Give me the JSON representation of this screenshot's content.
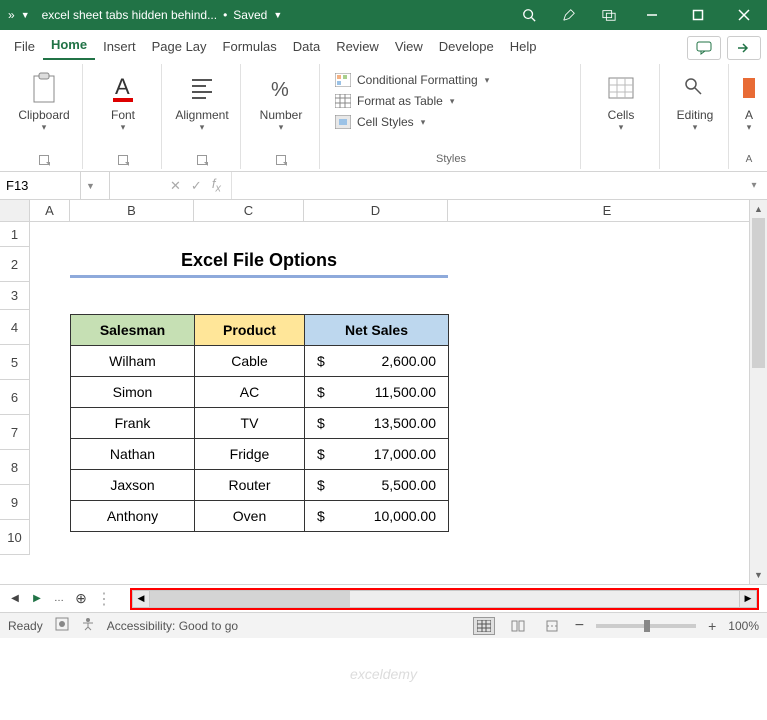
{
  "titlebar": {
    "filename": "excel sheet tabs hidden behind...",
    "saved": "Saved"
  },
  "tabs": {
    "file": "File",
    "home": "Home",
    "insert": "Insert",
    "pagelay": "Page Lay",
    "formulas": "Formulas",
    "data": "Data",
    "review": "Review",
    "view": "View",
    "developer": "Develope",
    "help": "Help"
  },
  "ribbon": {
    "clipboard": "Clipboard",
    "font": "Font",
    "alignment": "Alignment",
    "number": "Number",
    "condfmt": "Conditional Formatting",
    "fmttable": "Format as Table",
    "cellstyles": "Cell Styles",
    "styles": "Styles",
    "cells": "Cells",
    "editing": "Editing",
    "acut": "A"
  },
  "namebox": "F13",
  "columns": {
    "a": "A",
    "b": "B",
    "c": "C",
    "d": "D",
    "e": "E"
  },
  "rows": {
    "r1": "1",
    "r2": "2",
    "r3": "3",
    "r4": "4",
    "r5": "5",
    "r6": "6",
    "r7": "7",
    "r8": "8",
    "r9": "9",
    "r10": "10"
  },
  "sheet": {
    "title": "Excel File Options",
    "headers": {
      "salesman": "Salesman",
      "product": "Product",
      "netsales": "Net Sales"
    },
    "currency": "$",
    "data": [
      {
        "s": "Wilham",
        "p": "Cable",
        "n": "2,600.00"
      },
      {
        "s": "Simon",
        "p": "AC",
        "n": "11,500.00"
      },
      {
        "s": "Frank",
        "p": "TV",
        "n": "13,500.00"
      },
      {
        "s": "Nathan",
        "p": "Fridge",
        "n": "17,000.00"
      },
      {
        "s": "Jaxson",
        "p": "Router",
        "n": "5,500.00"
      },
      {
        "s": "Anthony",
        "p": "Oven",
        "n": "10,000.00"
      }
    ]
  },
  "status": {
    "ready": "Ready",
    "access": "Accessibility: Good to go",
    "zoom": "100%"
  },
  "watermark": "exceldemy"
}
